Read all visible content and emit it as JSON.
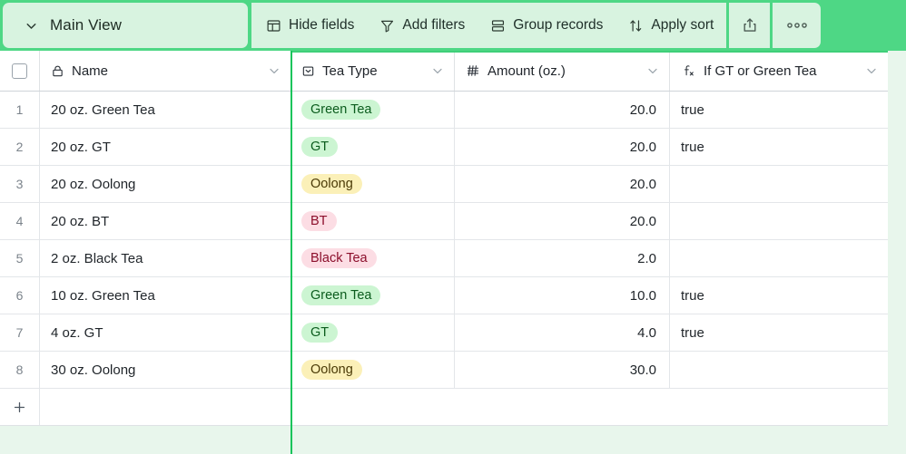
{
  "toolbar": {
    "view_chevron_icon": "chevron-down-icon",
    "view_name": "Main View",
    "buttons": [
      {
        "label": "Hide fields",
        "icon": "hide-fields-icon"
      },
      {
        "label": "Add filters",
        "icon": "filter-icon"
      },
      {
        "label": "Group records",
        "icon": "group-icon"
      },
      {
        "label": "Apply sort",
        "icon": "sort-icon"
      }
    ],
    "share_icon": "share-icon",
    "more_icon": "more-options-icon",
    "background_color": "#4ed785",
    "panel_color": "#d8f3e0"
  },
  "grid": {
    "select_all_checkbox": "",
    "columns": [
      {
        "label": "Name",
        "icon": "lock-icon",
        "type": "text"
      },
      {
        "label": "Tea Type",
        "icon": "single-select-icon",
        "type": "select"
      },
      {
        "label": "Amount (oz.)",
        "icon": "number-icon",
        "type": "number"
      },
      {
        "label": "If GT or Green Tea",
        "icon": "formula-icon",
        "type": "formula"
      }
    ],
    "rows": [
      {
        "index": "1",
        "name": "20 oz. Green Tea",
        "tea_type": "Green Tea",
        "tag_color": "green",
        "amount": "20.0",
        "formula": "true"
      },
      {
        "index": "2",
        "name": "20 oz. GT",
        "tea_type": "GT",
        "tag_color": "green",
        "amount": "20.0",
        "formula": "true"
      },
      {
        "index": "3",
        "name": "20 oz. Oolong",
        "tea_type": "Oolong",
        "tag_color": "yellow",
        "amount": "20.0",
        "formula": ""
      },
      {
        "index": "4",
        "name": "20 oz. BT",
        "tea_type": "BT",
        "tag_color": "pink",
        "amount": "20.0",
        "formula": ""
      },
      {
        "index": "5",
        "name": "2 oz. Black Tea",
        "tea_type": "Black Tea",
        "tag_color": "pink",
        "amount": "2.0",
        "formula": ""
      },
      {
        "index": "6",
        "name": "10 oz. Green Tea",
        "tea_type": "Green Tea",
        "tag_color": "green",
        "amount": "10.0",
        "formula": "true"
      },
      {
        "index": "7",
        "name": "4 oz. GT",
        "tea_type": "GT",
        "tag_color": "green",
        "amount": "4.0",
        "formula": "true"
      },
      {
        "index": "8",
        "name": "30 oz. Oolong",
        "tea_type": "Oolong",
        "tag_color": "yellow",
        "amount": "30.0",
        "formula": ""
      }
    ],
    "add_row_icon": "plus-icon",
    "tag_colors": {
      "green": {
        "bg": "#ccf5d2",
        "fg": "#0b5c1d"
      },
      "yellow": {
        "bg": "#fbf0b8",
        "fg": "#4a3a06"
      },
      "pink": {
        "bg": "#fcdde4",
        "fg": "#8c0f2c"
      }
    },
    "divider_color": "#16c45b"
  }
}
